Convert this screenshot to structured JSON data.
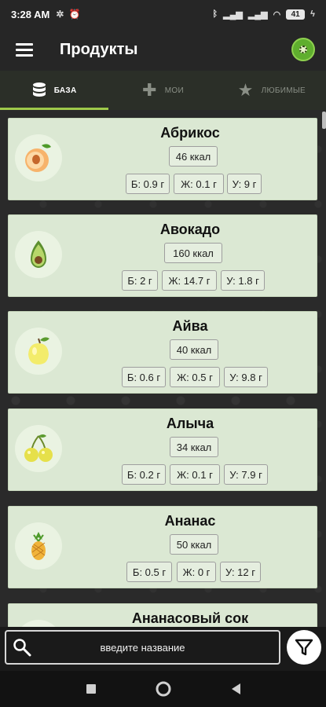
{
  "status": {
    "time": "3:28 AM",
    "battery": "41"
  },
  "appbar": {
    "title": "Продукты"
  },
  "tabs": [
    {
      "label": "БАЗА",
      "icon": "database-icon",
      "active": true
    },
    {
      "label": "МОИ",
      "icon": "plus-icon",
      "active": false
    },
    {
      "label": "ЛЮБИМЫЕ",
      "icon": "star-icon",
      "active": false
    }
  ],
  "products": [
    {
      "name": "Абрикос",
      "icon": "apricot-icon",
      "kcal": "46 ккал",
      "protein": "Б: 0.9 г",
      "fat": "Ж: 0.1 г",
      "carbs": "У: 9 г"
    },
    {
      "name": "Авокадо",
      "icon": "avocado-icon",
      "kcal": "160 ккал",
      "protein": "Б: 2 г",
      "fat": "Ж: 14.7 г",
      "carbs": "У: 1.8 г"
    },
    {
      "name": "Айва",
      "icon": "quince-icon",
      "kcal": "40 ккал",
      "protein": "Б: 0.6 г",
      "fat": "Ж: 0.5 г",
      "carbs": "У: 9.8 г"
    },
    {
      "name": "Алыча",
      "icon": "cherry-plum-icon",
      "kcal": "34 ккал",
      "protein": "Б: 0.2 г",
      "fat": "Ж: 0.1 г",
      "carbs": "У: 7.9 г"
    },
    {
      "name": "Ананас",
      "icon": "pineapple-icon",
      "kcal": "50 ккал",
      "protein": "Б: 0.5 г",
      "fat": "Ж: 0 г",
      "carbs": "У: 12 г"
    },
    {
      "name": "Ананасовый сок",
      "icon": "juice-icon"
    }
  ],
  "search": {
    "placeholder": "введите название"
  },
  "colors": {
    "card_bg": "#dbe8d3",
    "accent": "#9ec94a",
    "bar_bg": "#262626"
  }
}
